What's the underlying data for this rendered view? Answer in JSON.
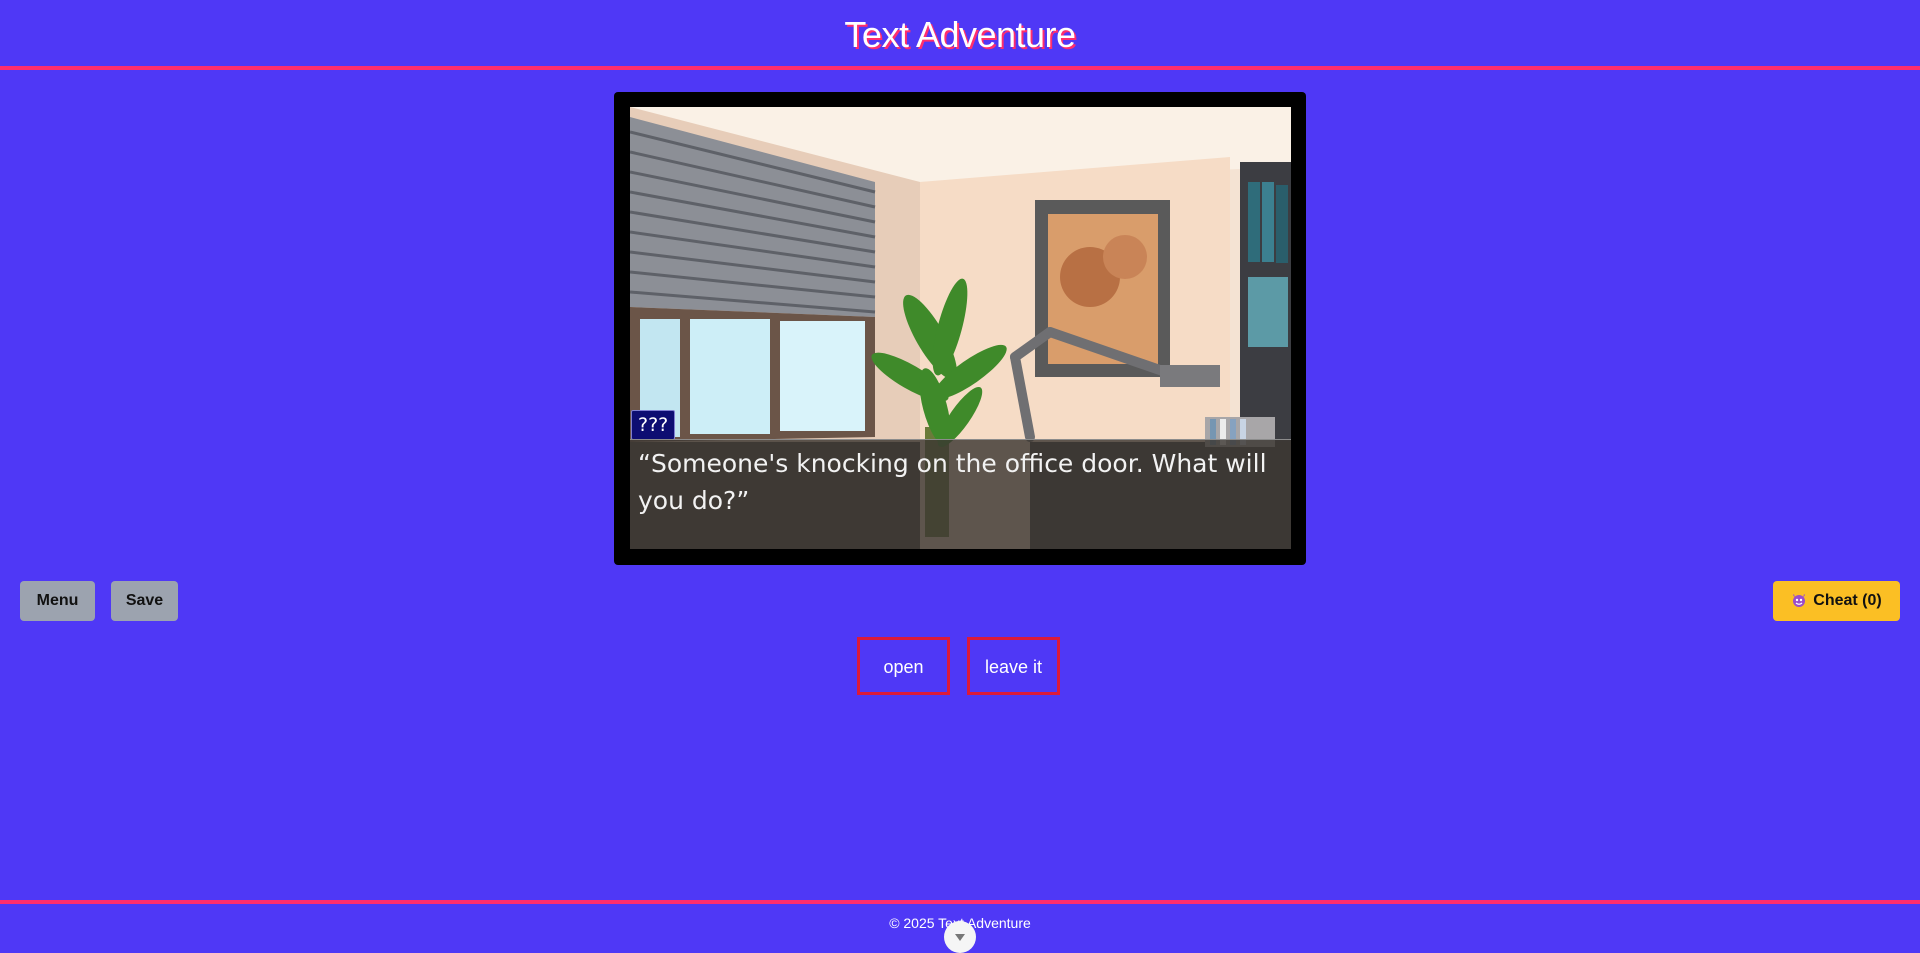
{
  "header": {
    "title": "Text Adventure"
  },
  "game": {
    "speaker": "???",
    "dialogue": "“Someone's knocking on the office door. What will you do?”",
    "scene_icon": "office-background"
  },
  "controls": {
    "menu_label": "Menu",
    "save_label": "Save",
    "cheat_label": "Cheat (0)",
    "cheat_icon": "devil-face-icon"
  },
  "choices": [
    {
      "label": "open"
    },
    {
      "label": "leave it"
    }
  ],
  "footer": {
    "copyright": "© 2025 Text Adventure",
    "scroll_icon": "chevron-down-icon"
  },
  "colors": {
    "background": "#4f38f6",
    "accent": "#ff2d6e",
    "choice_border": "#dc1a3a",
    "cheat": "#fbbf24",
    "grey_button": "#9ca3af"
  }
}
